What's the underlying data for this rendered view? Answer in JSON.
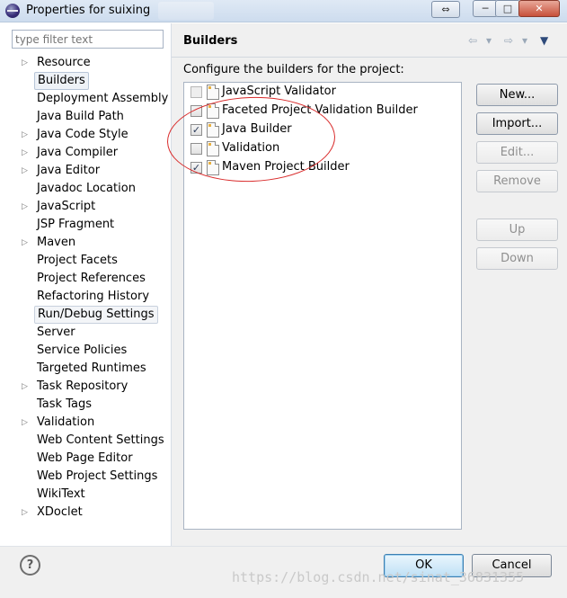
{
  "window": {
    "title": "Properties for suixing",
    "controls": {
      "swap_glyph": "⇔",
      "minimize_glyph": "─",
      "maximize_glyph": "□",
      "close_glyph": "✕"
    }
  },
  "filter": {
    "placeholder": "type filter text",
    "value": ""
  },
  "nav": {
    "items": [
      {
        "label": "Resource",
        "expandable": true
      },
      {
        "label": "Builders",
        "expandable": false,
        "selected": true
      },
      {
        "label": "Deployment Assembly",
        "expandable": false
      },
      {
        "label": "Java Build Path",
        "expandable": false
      },
      {
        "label": "Java Code Style",
        "expandable": true
      },
      {
        "label": "Java Compiler",
        "expandable": true
      },
      {
        "label": "Java Editor",
        "expandable": true
      },
      {
        "label": "Javadoc Location",
        "expandable": false
      },
      {
        "label": "JavaScript",
        "expandable": true
      },
      {
        "label": "JSP Fragment",
        "expandable": false
      },
      {
        "label": "Maven",
        "expandable": true
      },
      {
        "label": "Project Facets",
        "expandable": false
      },
      {
        "label": "Project References",
        "expandable": false
      },
      {
        "label": "Refactoring History",
        "expandable": false
      },
      {
        "label": "Run/Debug Settings",
        "expandable": false,
        "hover": true
      },
      {
        "label": "Server",
        "expandable": false
      },
      {
        "label": "Service Policies",
        "expandable": false
      },
      {
        "label": "Targeted Runtimes",
        "expandable": false
      },
      {
        "label": "Task Repository",
        "expandable": true
      },
      {
        "label": "Task Tags",
        "expandable": false
      },
      {
        "label": "Validation",
        "expandable": true
      },
      {
        "label": "Web Content Settings",
        "expandable": false
      },
      {
        "label": "Web Page Editor",
        "expandable": false
      },
      {
        "label": "Web Project Settings",
        "expandable": false
      },
      {
        "label": "WikiText",
        "expandable": false
      },
      {
        "label": "XDoclet",
        "expandable": true
      }
    ]
  },
  "page": {
    "title": "Builders",
    "description": "Configure the builders for the project:",
    "nav_glyphs": {
      "back": "⇦",
      "forward": "⇨",
      "dropdown": "▾",
      "menu": "▼"
    }
  },
  "builders": [
    {
      "label": "JavaScript Validator",
      "checked": false,
      "enabled": false
    },
    {
      "label": "Faceted Project Validation Builder",
      "checked": false,
      "enabled": true
    },
    {
      "label": "Java Builder",
      "checked": true,
      "enabled": true
    },
    {
      "label": "Validation",
      "checked": false,
      "enabled": true
    },
    {
      "label": "Maven Project Builder",
      "checked": true,
      "enabled": true
    }
  ],
  "buttons": {
    "new": "New...",
    "import": "Import...",
    "edit": "Edit...",
    "remove": "Remove",
    "up": "Up",
    "down": "Down",
    "ok": "OK",
    "cancel": "Cancel"
  },
  "help": {
    "glyph": "?"
  },
  "watermark": "https://blog.csdn.net/sinat_36831355",
  "colors": {
    "annotation_circle": "#d92b2b",
    "ok_accent": "#3c7fb1"
  }
}
